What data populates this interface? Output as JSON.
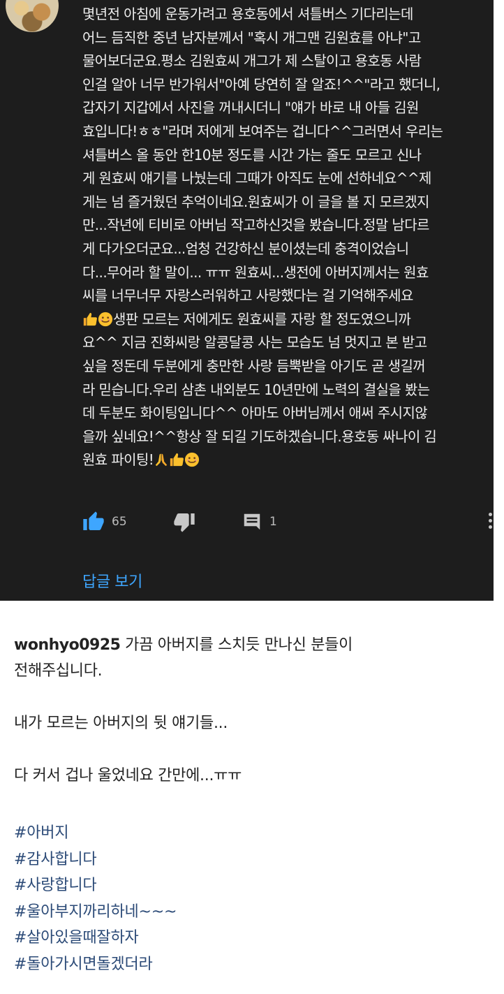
{
  "comment": {
    "lines": [
      "몇년전 아침에 운동가려고 용호동에서 셔틀버스 기다리는데",
      "어느 듬직한 중년 남자분께서 \"혹시 개그맨 김원효를 아냐\"고",
      "물어보더군요.평소 김원효씨 개그가 제 스탈이고 용호동 사람",
      "인걸 알아 너무 반가워서\"아예 당연히 잘 알죠!^^\"라고 했더니,",
      "갑자기 지갑에서 사진을 꺼내시더니 \"얘가 바로 내 아들 김원",
      "효입니다!ㅎㅎ\"라며 저에게 보여주는 겁니다^^그러면서 우리는",
      "셔틀버스 올 동안 한10분 정도를 시간 가는 줄도 모르고 신나",
      "게 원효씨 얘기를 나눴는데 그때가 아직도 눈에 선하네요^^제",
      "게는 넘 즐거웠던 추억이네요.원효씨가 이 글을 볼 지 모르겠지",
      "만...작년에 티비로 아버님 작고하신것을 봤습니다.정말 남다르",
      "게 다가오더군요...엄청 건강하신 분이셨는데 충격이었습니",
      "다...무어라 할 말이... ㅠㅠ 원효씨...생전에 아버지께서는 원효",
      "씨를 너무너무 자랑스러워하고 사랑했다는 걸 기억해주세요",
      "생판 모르는 저에게도 원효씨를 자랑 할 정도였으니까",
      "요^^ 지금 진화씨랑 알콩달콩 사는 모습도 넘 멋지고 본 받고",
      "싶을 정돈데 두분에게 충만한 사랑 듬뿍받을 아기도 곧 생길꺼",
      "라 믿습니다.우리 삼촌 내외분도 10년만에 노력의 결실을 봤는",
      "데 두분도 화이팅입니다^^ 아마도 아버님께서 애써 주시지않",
      "을까 싶네요!^^항상 잘 되길 기도하겠습니다.용호동 싸나이 김",
      "원효 파이팅!"
    ],
    "like_count": "65",
    "reply_count": "1",
    "view_replies": "답글 보기",
    "icons": {
      "like": "thumbs-up-icon",
      "dislike": "thumbs-down-icon",
      "reply": "comment-icon",
      "more": "more-vert-icon"
    },
    "colors": {
      "background": "#1d1d1d",
      "text": "#eeeeee",
      "link": "#3ea6ff",
      "like_active": "#3ea6ff"
    }
  },
  "caption": {
    "username": "wonhyo0925",
    "line1": "가끔 아버지를 스치듯 만나신 분들이",
    "line2": "전해주십니다.",
    "line3": "내가 모르는 아버지의 뒷 얘기들...",
    "line4": "다 커서 겁나 울었네요 간만에...ㅠㅠ",
    "hashtags": [
      "#아버지",
      "#감사합니다",
      "#사랑합니다",
      "#울아부지까리하네~~~",
      "#살아있을때잘하자",
      "#돌아가시면돌겠더라"
    ],
    "colors": {
      "text": "#222222",
      "hashtag": "#2b4a77"
    }
  }
}
